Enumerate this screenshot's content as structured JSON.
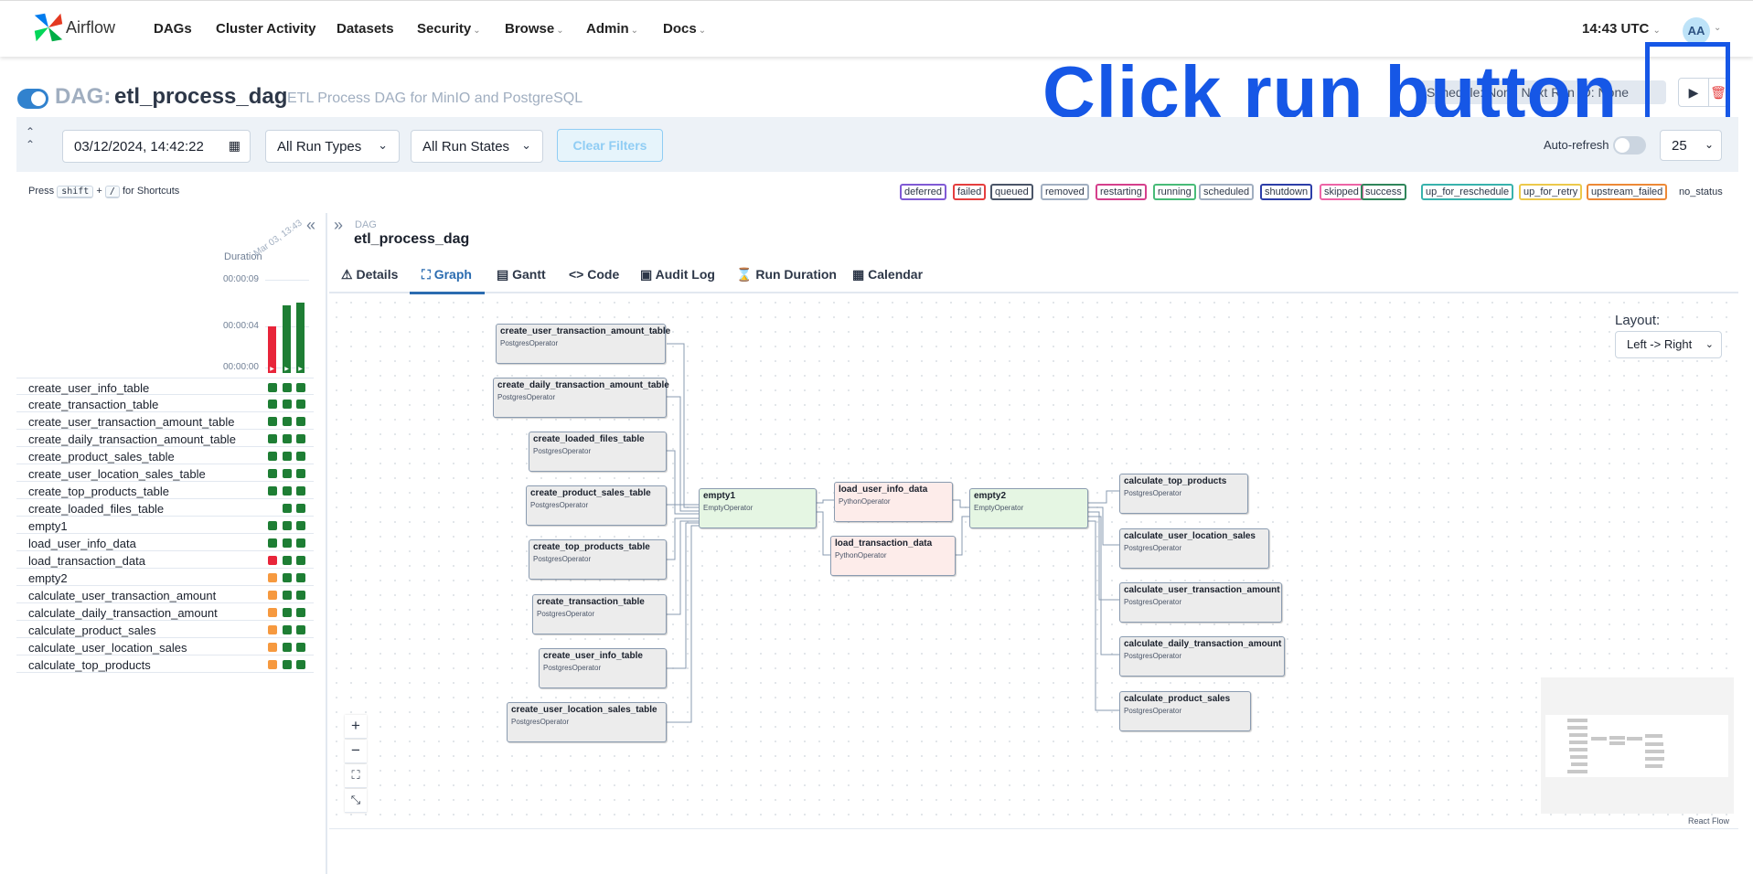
{
  "nav": {
    "brand": "Airflow",
    "items": [
      {
        "label": "DAGs",
        "caret": ""
      },
      {
        "label": "Cluster Activity",
        "caret": ""
      },
      {
        "label": "Datasets",
        "caret": ""
      },
      {
        "label": "Security",
        "caret": "⌄"
      },
      {
        "label": "Browse",
        "caret": "⌄"
      },
      {
        "label": "Admin",
        "caret": "⌄"
      },
      {
        "label": "Docs",
        "caret": "⌄"
      }
    ],
    "clock": "14:43 UTC",
    "clock_caret": "⌄",
    "avatar": "AA"
  },
  "dag": {
    "prefix": "DAG:",
    "title": "etl_process_dag",
    "description": "ETL Process DAG for MinIO and PostgreSQL",
    "schedule_badge": "Schedule: None   Next Run ID: None",
    "paused": false
  },
  "overlay": {
    "instruction": "Click run button",
    "color": "#1657e6"
  },
  "filters": {
    "date": "03/12/2024, 14:42:22",
    "run_types": "All Run Types",
    "run_states": "All Run States",
    "clear": "Clear Filters",
    "autorefresh": "Auto-refresh",
    "page_size": "25"
  },
  "shortcuts": {
    "press": "Press",
    "key1": "shift",
    "plus": "+",
    "key2": "/",
    "suffix": "for Shortcuts"
  },
  "legend": [
    {
      "label": "deferred",
      "color": "#805ad5"
    },
    {
      "label": "failed",
      "color": "#e53e3e"
    },
    {
      "label": "queued",
      "color": "#4a5568"
    },
    {
      "label": "removed",
      "color": "#a0aec0"
    },
    {
      "label": "restarting",
      "color": "#d53f8c"
    },
    {
      "label": "running",
      "color": "#48bb78"
    },
    {
      "label": "scheduled",
      "color": "#a0aec0"
    },
    {
      "label": "shutdown",
      "color": "#2c3ea8"
    },
    {
      "label": "skipped",
      "color": "#ed64a6"
    },
    {
      "label": "success",
      "color": "#2f855a"
    },
    {
      "label": "up_for_reschedule",
      "color": "#38b2ac"
    },
    {
      "label": "up_for_retry",
      "color": "#ecc94b"
    },
    {
      "label": "upstream_failed",
      "color": "#ed8936"
    }
  ],
  "legend_nostatus": "no_status",
  "grid": {
    "duration_label": "Duration",
    "date_tick": "Mar 03, 13:43",
    "ticks": [
      "00:00:09",
      "00:00:04",
      "00:00:00"
    ],
    "runs": [
      {
        "duration_fraction": 0.5,
        "state": "failed",
        "color": "#e8253a"
      },
      {
        "duration_fraction": 0.73,
        "state": "success",
        "color": "#1e7e34"
      },
      {
        "duration_fraction": 0.75,
        "state": "success",
        "color": "#1e7e34"
      }
    ],
    "tasks": [
      {
        "name": "create_user_info_table",
        "states": [
          "success",
          "success",
          "success"
        ]
      },
      {
        "name": "create_transaction_table",
        "states": [
          "success",
          "success",
          "success"
        ]
      },
      {
        "name": "create_user_transaction_amount_table",
        "states": [
          "success",
          "success",
          "success"
        ]
      },
      {
        "name": "create_daily_transaction_amount_table",
        "states": [
          "success",
          "success",
          "success"
        ]
      },
      {
        "name": "create_product_sales_table",
        "states": [
          "success",
          "success",
          "success"
        ]
      },
      {
        "name": "create_user_location_sales_table",
        "states": [
          "success",
          "success",
          "success"
        ]
      },
      {
        "name": "create_top_products_table",
        "states": [
          "success",
          "success",
          "success"
        ]
      },
      {
        "name": "create_loaded_files_table",
        "states": [
          "none",
          "success",
          "success"
        ]
      },
      {
        "name": "empty1",
        "states": [
          "success",
          "success",
          "success"
        ]
      },
      {
        "name": "load_user_info_data",
        "states": [
          "success",
          "success",
          "success"
        ]
      },
      {
        "name": "load_transaction_data",
        "states": [
          "failed",
          "success",
          "success"
        ]
      },
      {
        "name": "empty2",
        "states": [
          "upstream_failed",
          "success",
          "success"
        ]
      },
      {
        "name": "calculate_user_transaction_amount",
        "states": [
          "upstream_failed",
          "success",
          "success"
        ]
      },
      {
        "name": "calculate_daily_transaction_amount",
        "states": [
          "upstream_failed",
          "success",
          "success"
        ]
      },
      {
        "name": "calculate_product_sales",
        "states": [
          "upstream_failed",
          "success",
          "success"
        ]
      },
      {
        "name": "calculate_user_location_sales",
        "states": [
          "upstream_failed",
          "success",
          "success"
        ]
      },
      {
        "name": "calculate_top_products",
        "states": [
          "upstream_failed",
          "success",
          "success"
        ]
      }
    ],
    "state_colors": {
      "success": "#1e7e34",
      "failed": "#e8253a",
      "upstream_failed": "#f6993f"
    }
  },
  "details": {
    "breadcrumb_label": "DAG",
    "breadcrumb_title": "etl_process_dag",
    "tabs": [
      {
        "label": "Details",
        "icon": "⚠",
        "active": false
      },
      {
        "label": "Graph",
        "icon": "⛶",
        "active": true
      },
      {
        "label": "Gantt",
        "icon": "▤",
        "active": false
      },
      {
        "label": "Code",
        "icon": "<>",
        "active": false
      },
      {
        "label": "Audit Log",
        "icon": "▣",
        "active": false
      },
      {
        "label": "Run Duration",
        "icon": "⌛",
        "active": false
      },
      {
        "label": "Calendar",
        "icon": "▦",
        "active": false
      }
    ]
  },
  "graph": {
    "layout_label": "Layout:",
    "layout_value": "Left -> Right",
    "attribution": "React Flow",
    "zoom": [
      "+",
      "−",
      "⛶",
      "⤡"
    ],
    "nodes": [
      {
        "name": "create_user_transaction_amount_table",
        "operator": "PostgresOperator",
        "state": "grey"
      },
      {
        "name": "create_daily_transaction_amount_table",
        "operator": "PostgresOperator",
        "state": "grey"
      },
      {
        "name": "create_loaded_files_table",
        "operator": "PostgresOperator",
        "state": "grey"
      },
      {
        "name": "create_product_sales_table",
        "operator": "PostgresOperator",
        "state": "grey"
      },
      {
        "name": "create_top_products_table",
        "operator": "PostgresOperator",
        "state": "grey"
      },
      {
        "name": "create_transaction_table",
        "operator": "PostgresOperator",
        "state": "grey"
      },
      {
        "name": "create_user_info_table",
        "operator": "PostgresOperator",
        "state": "grey"
      },
      {
        "name": "create_user_location_sales_table",
        "operator": "PostgresOperator",
        "state": "grey"
      },
      {
        "name": "empty1",
        "operator": "EmptyOperator",
        "state": "green"
      },
      {
        "name": "load_user_info_data",
        "operator": "PythonOperator",
        "state": "pink"
      },
      {
        "name": "load_transaction_data",
        "operator": "PythonOperator",
        "state": "pink"
      },
      {
        "name": "empty2",
        "operator": "EmptyOperator",
        "state": "green"
      },
      {
        "name": "calculate_top_products",
        "operator": "PostgresOperator",
        "state": "grey"
      },
      {
        "name": "calculate_user_location_sales",
        "operator": "PostgresOperator",
        "state": "grey"
      },
      {
        "name": "calculate_user_transaction_amount",
        "operator": "PostgresOperator",
        "state": "grey"
      },
      {
        "name": "calculate_daily_transaction_amount",
        "operator": "PostgresOperator",
        "state": "grey"
      },
      {
        "name": "calculate_product_sales",
        "operator": "PostgresOperator",
        "state": "grey"
      }
    ]
  }
}
